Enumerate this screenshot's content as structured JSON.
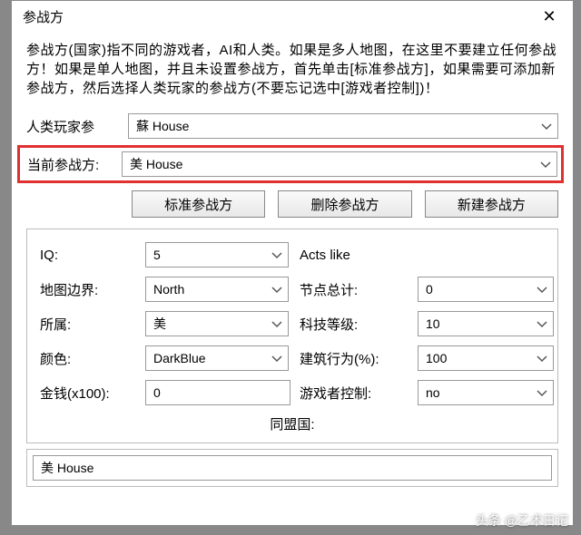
{
  "window": {
    "title": "参战方",
    "close": "✕"
  },
  "description": "参战方(国家)指不同的游戏者，AI和人类。如果是多人地图，在这里不要建立任何参战方！如果是单人地图，并且未设置参战方，首先单击[标准参战方]，如果需要可添加新参战方，然后选择人类玩家的参战方(不要忘记选中[游戏者控制])！",
  "humanPlayer": {
    "label": "人类玩家参",
    "value": "蘇 House"
  },
  "currentSide": {
    "label": "当前参战方:",
    "value": "美 House"
  },
  "buttons": {
    "standard": "标准参战方",
    "delete": "删除参战方",
    "create": "新建参战方"
  },
  "fields": {
    "iq": {
      "label": "IQ:",
      "value": "5"
    },
    "actsLike": {
      "label": "Acts like"
    },
    "mapEdge": {
      "label": "地图边界:",
      "value": "North"
    },
    "nodeCount": {
      "label": "节点总计:",
      "value": "0"
    },
    "side": {
      "label": "所属:",
      "value": "美"
    },
    "techLevel": {
      "label": "科技等级:",
      "value": "10"
    },
    "color": {
      "label": "颜色:",
      "value": "DarkBlue"
    },
    "buildPct": {
      "label": "建筑行为(%):",
      "value": "100"
    },
    "money": {
      "label": "金钱(x100):",
      "value": "0"
    },
    "playerControl": {
      "label": "游戏者控制:",
      "value": "no"
    }
  },
  "ally": {
    "label": "同盟国:",
    "value": "美 House"
  },
  "watermark": "头条 @乙术日记"
}
